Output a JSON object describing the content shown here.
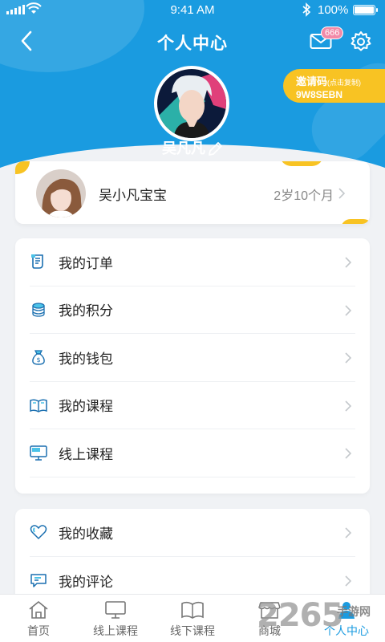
{
  "status_bar": {
    "time": "9:41 AM",
    "battery_percent": "100%"
  },
  "header": {
    "title": "个人中心",
    "mail_badge": "666",
    "username": "吴凡凡",
    "invite": {
      "label": "邀请码",
      "hint": "(点击复制)",
      "code": "9W8SEBN"
    }
  },
  "child": {
    "name": "吴小凡宝宝",
    "age": "2岁10个月"
  },
  "menu_primary": [
    {
      "label": "我的订单",
      "icon": "order-icon"
    },
    {
      "label": "我的积分",
      "icon": "points-icon"
    },
    {
      "label": "我的钱包",
      "icon": "wallet-icon"
    },
    {
      "label": "我的课程",
      "icon": "book-icon"
    },
    {
      "label": "线上课程",
      "icon": "monitor-icon"
    }
  ],
  "menu_secondary": [
    {
      "label": "我的收藏",
      "icon": "heart-icon"
    },
    {
      "label": "我的评论",
      "icon": "comment-icon"
    }
  ],
  "tabbar": [
    {
      "label": "首页",
      "icon": "home-icon"
    },
    {
      "label": "线上课程",
      "icon": "monitor-icon"
    },
    {
      "label": "线下课程",
      "icon": "book-icon"
    },
    {
      "label": "商城",
      "icon": "shop-icon"
    },
    {
      "label": "个人中心",
      "icon": "person-icon",
      "active": true
    }
  ],
  "watermark": {
    "number": "2265",
    "text": "手游网"
  },
  "colors": {
    "primary": "#1a9be0",
    "accent": "#f8c323",
    "badge": "#f28aa8"
  }
}
